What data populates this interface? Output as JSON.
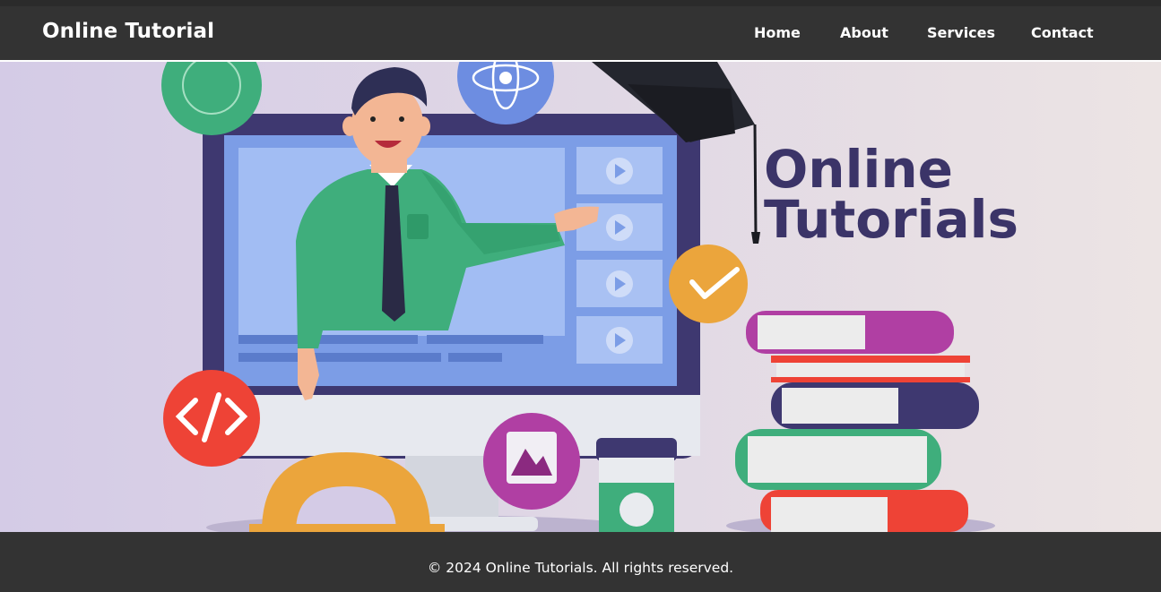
{
  "header": {
    "brand": "Online Tutorial",
    "nav": [
      {
        "label": "Home"
      },
      {
        "label": "About"
      },
      {
        "label": "Services"
      },
      {
        "label": "Contact"
      }
    ]
  },
  "hero": {
    "title_line1": "Online",
    "title_line2": "Tutorials",
    "colors": {
      "background_left": "#d4cbe6",
      "background_right": "#ece4e4",
      "title": "#3b3468"
    }
  },
  "footer": {
    "copyright": "© 2024 Online Tutorials. All rights reserved."
  }
}
